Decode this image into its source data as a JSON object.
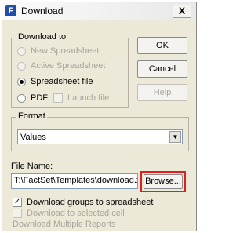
{
  "window": {
    "title": "Download",
    "app_icon": "F",
    "close_label": "X"
  },
  "download_to": {
    "label": "Download to",
    "new_spreadsheet": "New Spreadsheet",
    "active_spreadsheet": "Active Spreadsheet",
    "spreadsheet_file": "Spreadsheet file",
    "pdf": "PDF",
    "launch_file": "Launch file",
    "selected": "Spreadsheet file"
  },
  "buttons": {
    "ok": "OK",
    "cancel": "Cancel",
    "help": "Help",
    "browse": "Browse..."
  },
  "format": {
    "label": "Format",
    "value": "Values"
  },
  "file_name": {
    "label": "File Name:",
    "value": "T:\\FactSet\\Templates\\download.xls"
  },
  "options": {
    "download_groups": "Download groups to spreadsheet",
    "download_groups_checked": true,
    "download_selected_cell": "Download to selected cell",
    "download_selected_cell_checked": false
  },
  "download_multiple_reports": "Download Multiple Reports",
  "colors": {
    "highlight": "#e0201f",
    "title_icon": "#1f4fa8"
  }
}
